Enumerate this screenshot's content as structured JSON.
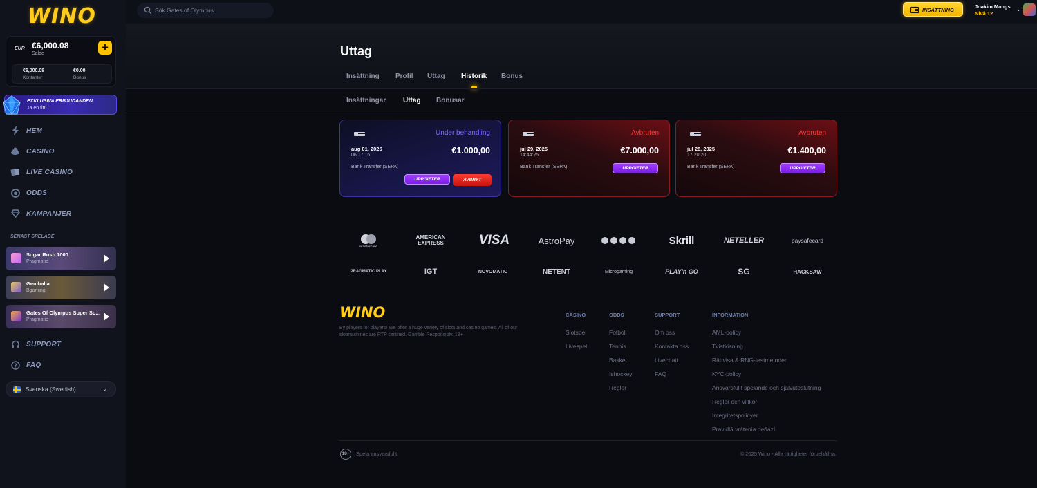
{
  "brand": {
    "logo_text": "WINO",
    "accent": "#ffc400"
  },
  "wallet": {
    "currency": "EUR",
    "balance": "€6,000.08",
    "balance_label": "Saldo",
    "cash_value": "€6,000.08",
    "cash_label": "Kontanter",
    "bonus_value": "€0.00",
    "bonus_label": "Bonus",
    "add_icon": "plus-icon"
  },
  "promo": {
    "title": "EXKLUSIVA ERBJUDANDEN",
    "subtitle": "Ta en titt!"
  },
  "nav": [
    {
      "label": "HEM",
      "icon": "lightning-icon"
    },
    {
      "label": "CASINO",
      "icon": "chips-icon"
    },
    {
      "label": "LIVE CASINO",
      "icon": "cards-icon"
    },
    {
      "label": "ODDS",
      "icon": "ball-icon"
    },
    {
      "label": "KAMPANJER",
      "icon": "diamond-icon"
    }
  ],
  "recent": {
    "title": "SENAST SPELADE",
    "games": [
      {
        "name": "Sugar Rush 1000",
        "provider": "Pragmatic"
      },
      {
        "name": "Gemhalla",
        "provider": "Bgaming"
      },
      {
        "name": "Gates Of Olympus Super Scatter",
        "provider": "Pragmatic"
      }
    ]
  },
  "support_nav": [
    {
      "label": "SUPPORT",
      "icon": "headset-icon"
    },
    {
      "label": "FAQ",
      "icon": "question-icon"
    }
  ],
  "language": {
    "label": "Svenska (Swedish)"
  },
  "topbar": {
    "search_placeholder": "Sök Gates of Olympus",
    "deposit_label": "INSÄTTNING",
    "user_name": "Joakim Mangs",
    "user_level": "Nivå 12"
  },
  "page": {
    "title": "Uttag",
    "tabs": [
      "Insättning",
      "Profil",
      "Uttag",
      "Historik",
      "Bonus"
    ],
    "active_tab": "Historik",
    "subtabs": [
      "Insättningar",
      "Uttag",
      "Bonusar"
    ],
    "active_subtab": "Uttag"
  },
  "withdrawals": [
    {
      "status": "Under behandling",
      "date": "aug 01, 2025",
      "time": "06:17:16",
      "amount": "€1.000,00",
      "method": "Bank Transfer (SEPA)",
      "details_label": "UPPGIFTER",
      "cancel_label": "AVBRYT"
    },
    {
      "status": "Avbruten",
      "date": "jul 29, 2025",
      "time": "14:44:25",
      "amount": "€7.000,00",
      "method": "Bank Transfer (SEPA)",
      "details_label": "UPPGIFTER"
    },
    {
      "status": "Avbruten",
      "date": "jul 28, 2025",
      "time": "17:20:20",
      "amount": "€1.400,00",
      "method": "Bank Transfer (SEPA)",
      "details_label": "UPPGIFTER"
    }
  ],
  "payment_logos": [
    "mastercard",
    "AMERICAN EXPRESS",
    "VISA",
    "AstroPay",
    "Skrill",
    "NETELLER",
    "paysafecard"
  ],
  "provider_logos": [
    "PRAGMATIC PLAY",
    "IGT",
    "NOVOMATIC",
    "NETENT",
    "Microgaming",
    "PLAY'n GO",
    "SG",
    "HACKSAW"
  ],
  "footer": {
    "logo_text": "WINO",
    "description": "By players for players! We offer a huge variety of slots and casino games. All of our slotmachines are RTP certified. Gamble Responsibly. 18+",
    "columns": [
      {
        "title": "CASINO",
        "links": [
          "Slotspel",
          "Livespel"
        ]
      },
      {
        "title": "ODDS",
        "links": [
          "Fotboll",
          "Tennis",
          "Basket",
          "Ishockey",
          "Regler"
        ]
      },
      {
        "title": "SUPPORT",
        "links": [
          "Om oss",
          "Kontakta oss",
          "Livechatt",
          "FAQ"
        ]
      },
      {
        "title": "INFORMATION",
        "links": [
          "AML-policy",
          "Tvistlösning",
          "Rättvisa & RNG-testmetoder",
          "KYC-policy",
          "Ansvarsfullt spelande och självuteslutning",
          "Regler och villkor",
          "Integritetspolicyer",
          "Pravidlá vrátenia peňazí"
        ]
      }
    ],
    "age_badge": "18+",
    "responsible": "Spela ansvarsfullt.",
    "copyright": "© 2025 Wino - Alla rättigheter förbehållna."
  }
}
